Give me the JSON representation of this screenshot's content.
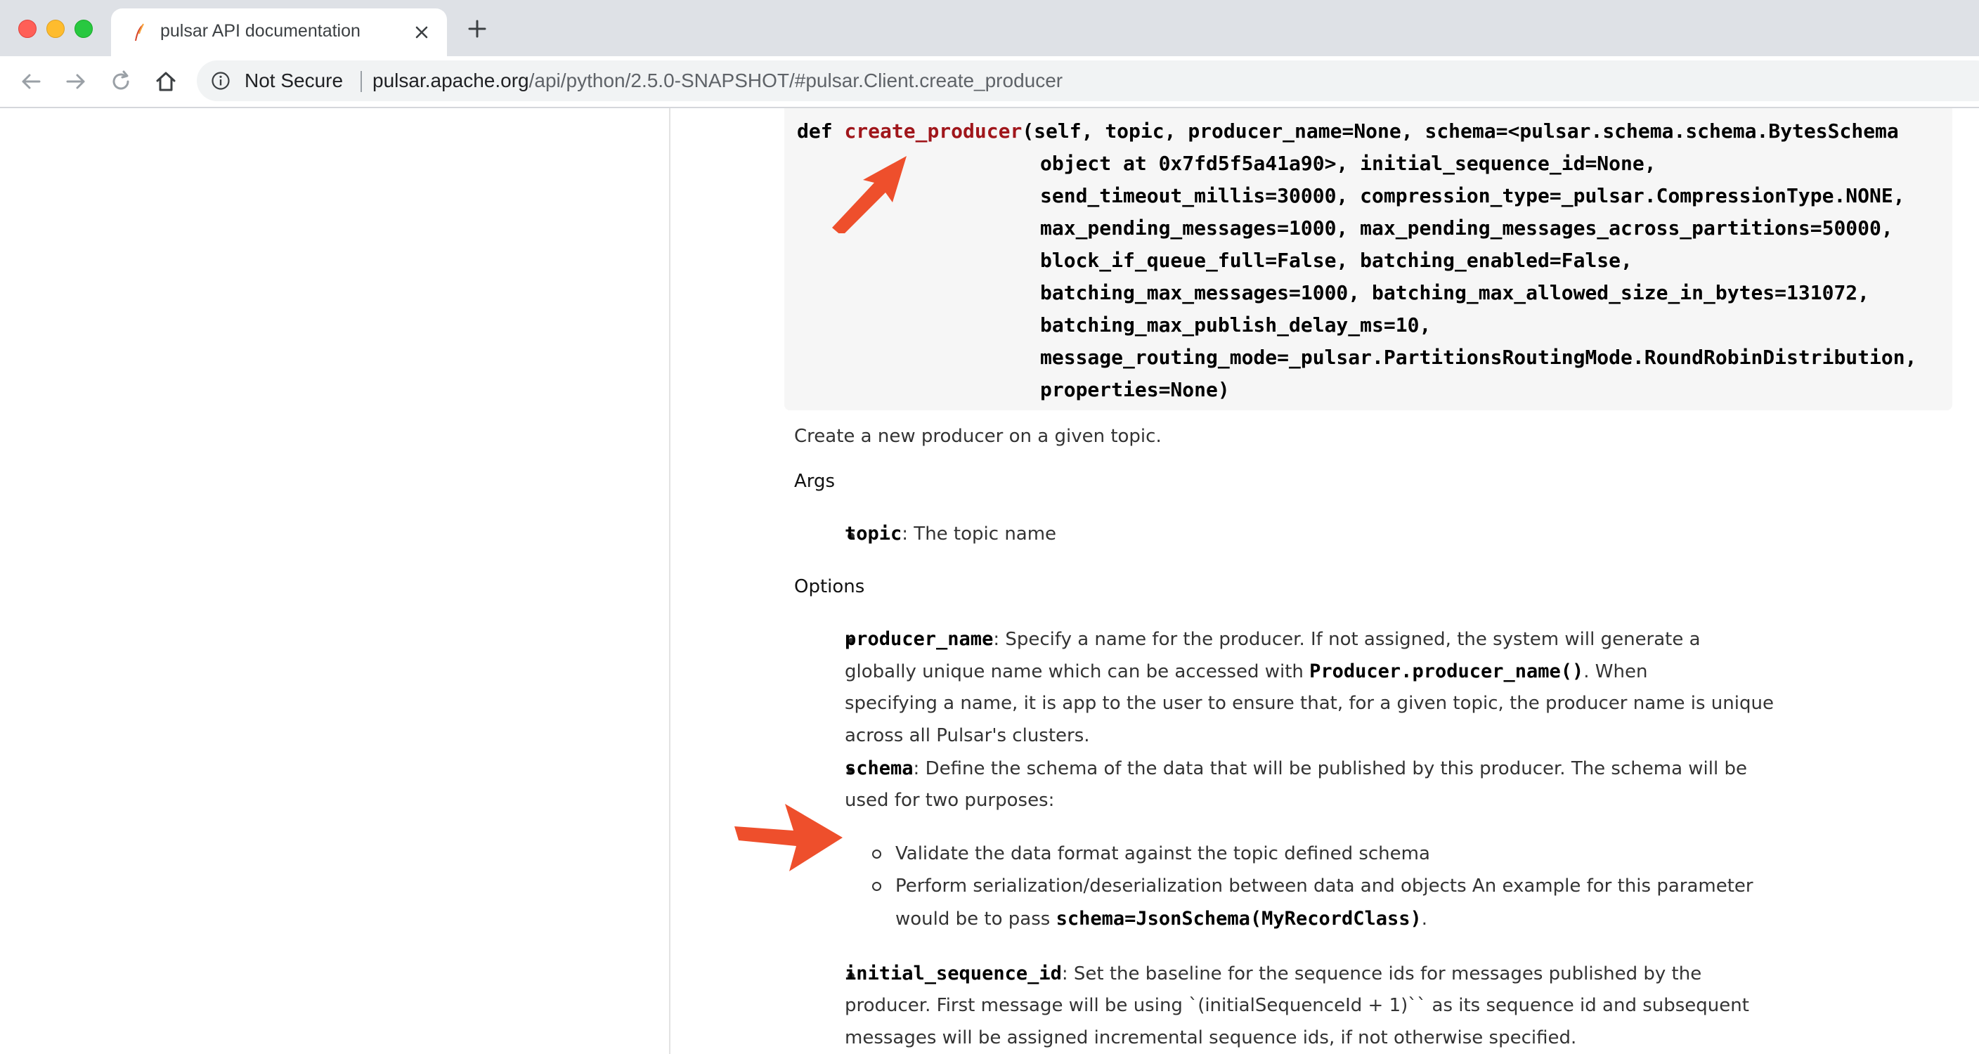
{
  "browser": {
    "tab_title": "pulsar API documentation",
    "security_label": "Not Secure",
    "url_host": "pulsar.apache.org",
    "url_path": "/api/python/2.5.0-SNAPSHOT/#pulsar.Client.create_producer"
  },
  "code": {
    "def_kw": "def ",
    "fn_name": "create_producer",
    "lines": [
      "(self, topic, producer_name=None, schema=<pulsar.schema.schema.BytesSchema",
      "object at 0x7fd5f5a41a90>, initial_sequence_id=None,",
      "send_timeout_millis=30000, compression_type=_pulsar.CompressionType.NONE,",
      "max_pending_messages=1000, max_pending_messages_across_partitions=50000,",
      "block_if_queue_full=False, batching_enabled=False,",
      "batching_max_messages=1000, batching_max_allowed_size_in_bytes=131072,",
      "batching_max_publish_delay_ms=10,",
      "message_routing_mode=_pulsar.PartitionsRoutingMode.RoundRobinDistribution,",
      "properties=None)"
    ]
  },
  "doc": {
    "summary": "Create a new producer on a given topic.",
    "args_heading": "Args",
    "args": [
      {
        "name": "topic",
        "desc": ": The topic name"
      }
    ],
    "options_heading": "Options",
    "producer_name": {
      "name": "producer_name",
      "l1": ": Specify a name for the producer. If not assigned, the system will generate a",
      "l2a": "globally unique name which can be accessed with ",
      "l2code": "Producer.producer_name()",
      "l2b": ". When",
      "l3": "specifying a name, it is app to the user to ensure that, for a given topic, the producer name is unique",
      "l4": "across all Pulsar's clusters."
    },
    "schema": {
      "name": "schema",
      "l1": ": Define the schema of the data that will be published by this producer. The schema will be",
      "l2": "used for two purposes:",
      "sub1": "Validate the data format against the topic defined schema",
      "sub2_l1": "Perform serialization/deserialization between data and objects An example for this parameter",
      "sub2_l2a": "would be to pass ",
      "sub2_code": "schema=JsonSchema(MyRecordClass)",
      "sub2_l2b": "."
    },
    "initial_sequence_id": {
      "name": "initial_sequence_id",
      "l1": ": Set the baseline for the sequence ids for messages published by the",
      "l2": "producer. First message will be using `(initialSequenceId + 1)`` as its sequence id and subsequent",
      "l3": "messages will be assigned incremental sequence ids, if not otherwise specified."
    }
  },
  "colors": {
    "function_name": "#a0161b",
    "annotation_arrow": "#ee4f2c"
  }
}
